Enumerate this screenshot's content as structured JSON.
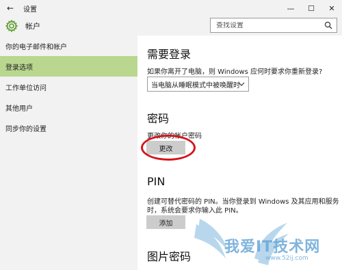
{
  "window": {
    "title": "设置",
    "back_icon": "←",
    "minimize": "—",
    "maximize": "☐",
    "close": "✕"
  },
  "header": {
    "section_title": "帐户",
    "search_placeholder": "查找设置"
  },
  "sidebar": {
    "items": [
      {
        "label": "你的电子邮件和帐户",
        "active": false
      },
      {
        "label": "登录选项",
        "active": true
      },
      {
        "label": "工作单位访问",
        "active": false
      },
      {
        "label": "其他用户",
        "active": false
      },
      {
        "label": "同步你的设置",
        "active": false
      }
    ]
  },
  "main": {
    "require_signin": {
      "heading": "需要登录",
      "question": "如果你离开了电脑，则 Windows 应何时要求你重新登录?",
      "selected_option": "当电脑从睡眠模式中被唤醒时"
    },
    "password": {
      "heading": "密码",
      "description": "更改你的帐户密码",
      "button": "更改"
    },
    "pin": {
      "heading": "PIN",
      "description_line1": "创建可替代密码的 PIN。当你登录到 Windows 及其应用和服务",
      "description_line2": "时，系统会要求你输入此 PIN。",
      "button": "添加"
    },
    "picture_password": {
      "heading": "图片密码"
    }
  },
  "watermark": {
    "text": "我爱IT技术网",
    "url": "www.52ij.com"
  },
  "colors": {
    "accent_green": "#b9d78f",
    "highlight_red": "#d4141c",
    "chrome_gray": "#f2f2f2"
  }
}
